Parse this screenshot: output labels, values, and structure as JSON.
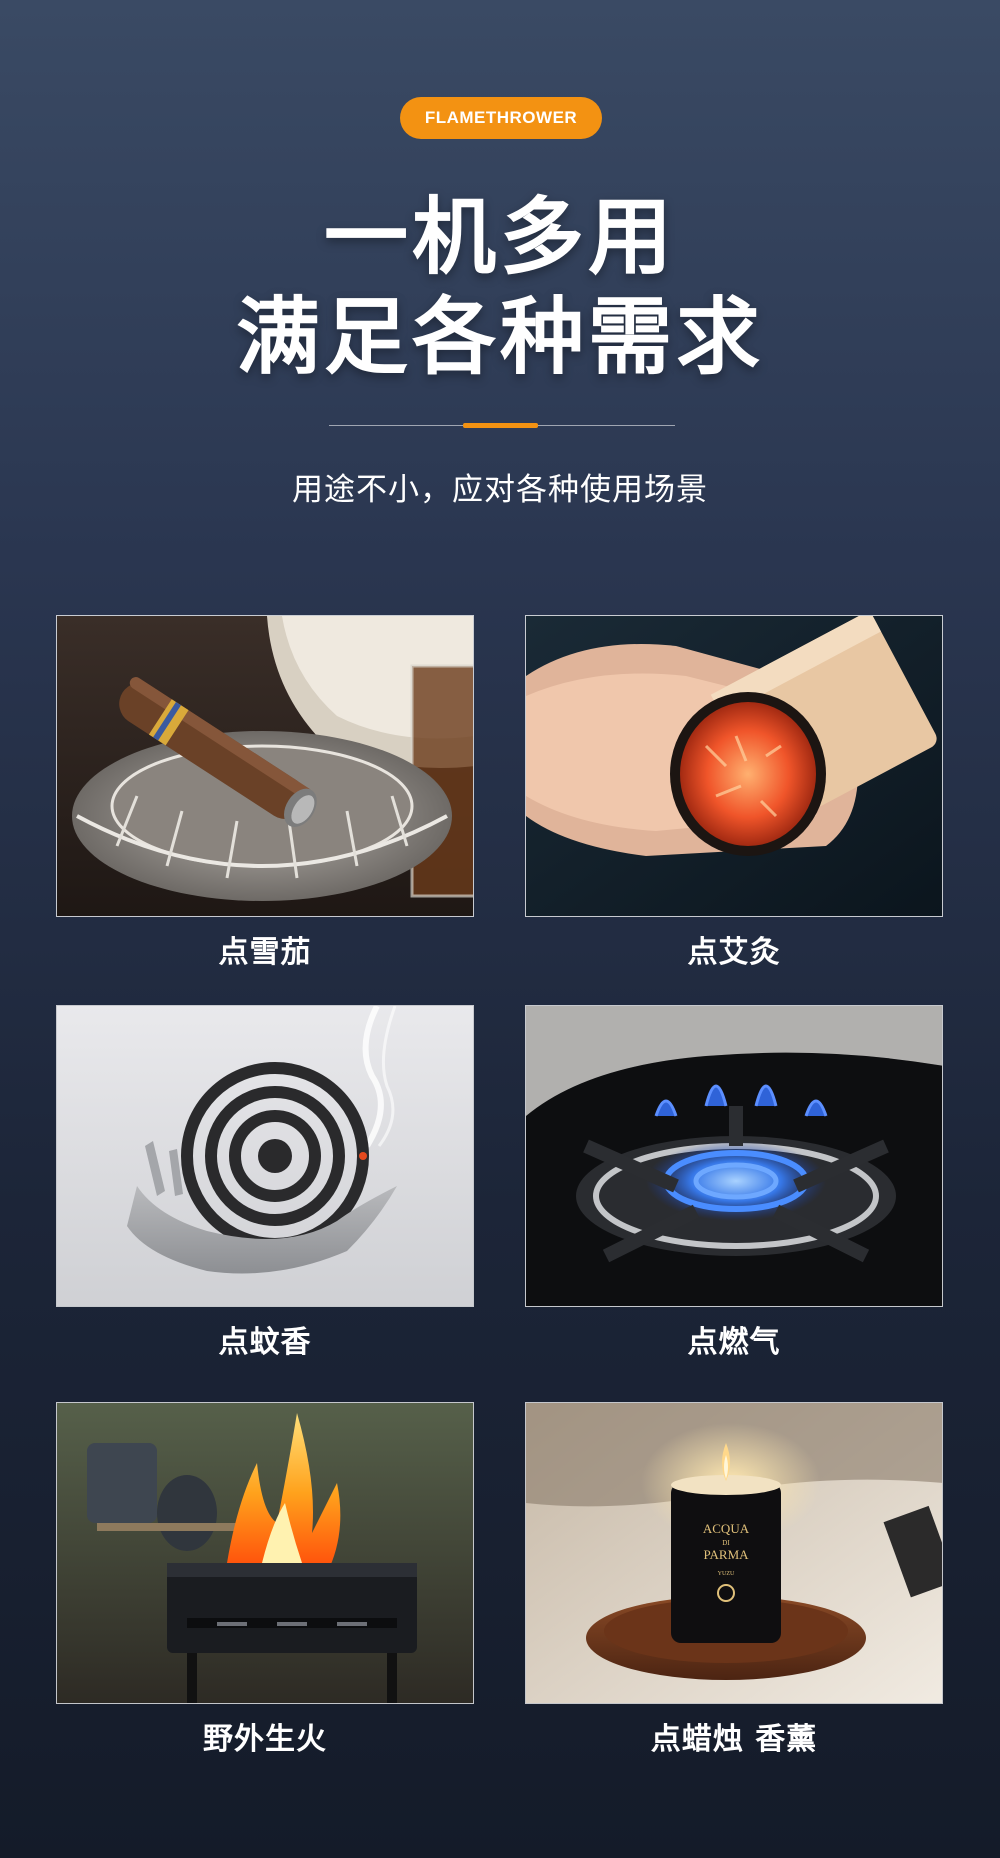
{
  "badge": "FLAMETHROWER",
  "title": {
    "line1": "一机多用",
    "line2": "满足各种需求"
  },
  "subtitle": "用途不小，应对各种使用场景",
  "scenes": [
    {
      "caption": "点雪茄",
      "icon": "cigar-ashtray-photo"
    },
    {
      "caption": "点艾灸",
      "icon": "moxa-stick-photo"
    },
    {
      "caption": "点蚊香",
      "icon": "mosquito-coil-photo"
    },
    {
      "caption": "点燃气",
      "icon": "gas-stove-photo"
    },
    {
      "caption": "野外生火",
      "icon": "campfire-grill-photo"
    },
    {
      "caption": "点蜡烛 香薰",
      "icon": "candle-photo"
    }
  ],
  "candle_label": {
    "line1": "ACQUA",
    "line2": "DI",
    "line3": "PARMA",
    "line4": "YUZU"
  },
  "colors": {
    "accent": "#f39212",
    "background_top": "#3a4a64",
    "background_bottom": "#141b29"
  }
}
